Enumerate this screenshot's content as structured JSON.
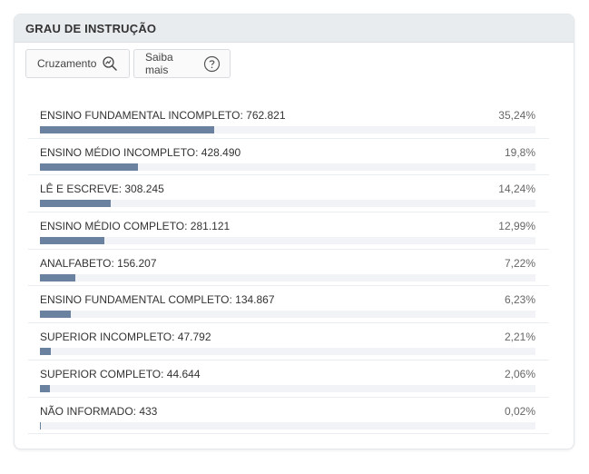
{
  "panel": {
    "title": "GRAU DE INSTRUÇÃO"
  },
  "toolbar": {
    "cross_label": "Cruzamento",
    "cross_icon": "magnifier-trend-icon",
    "info_label": "Saiba mais",
    "info_icon": "question-circle-icon"
  },
  "colors": {
    "bar": "#6a829f",
    "track": "#f1f3f6",
    "header_bg": "#e9ecef"
  },
  "chart_data": {
    "type": "bar",
    "orientation": "horizontal",
    "categories": [
      "ENSINO FUNDAMENTAL INCOMPLETO",
      "ENSINO MÉDIO INCOMPLETO",
      "LÊ E ESCREVE",
      "ENSINO MÉDIO COMPLETO",
      "ANALFABETO",
      "ENSINO FUNDAMENTAL COMPLETO",
      "SUPERIOR INCOMPLETO",
      "SUPERIOR COMPLETO",
      "NÃO INFORMADO"
    ],
    "labels": [
      "ENSINO FUNDAMENTAL INCOMPLETO: 762.821",
      "ENSINO MÉDIO INCOMPLETO: 428.490",
      "LÊ E ESCREVE: 308.245",
      "ENSINO MÉDIO COMPLETO: 281.121",
      "ANALFABETO: 156.207",
      "ENSINO FUNDAMENTAL COMPLETO: 134.867",
      "SUPERIOR INCOMPLETO: 47.792",
      "SUPERIOR COMPLETO: 44.644",
      "NÃO INFORMADO: 433"
    ],
    "values": [
      762821,
      428490,
      308245,
      281121,
      156207,
      134867,
      47792,
      44644,
      433
    ],
    "percent_labels": [
      "35,24%",
      "19,8%",
      "14,24%",
      "12,99%",
      "7,22%",
      "6,23%",
      "2,21%",
      "2,06%",
      "0,02%"
    ],
    "percents": [
      35.24,
      19.8,
      14.24,
      12.99,
      7.22,
      6.23,
      2.21,
      2.06,
      0.02
    ],
    "xlim": [
      0,
      100
    ]
  }
}
